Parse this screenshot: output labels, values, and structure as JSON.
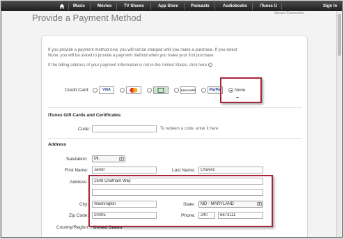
{
  "nav": {
    "items": [
      "Music",
      "Movies",
      "TV Shows",
      "App Store",
      "Podcasts",
      "Audiobooks",
      "iTunes U"
    ],
    "sign_in": "Sign In"
  },
  "secure_note": "Secure Connection",
  "title": "Provide a Payment Method",
  "intro": {
    "line1": "If you provide a payment method now, you will not be charged until you make a purchase. If you select",
    "line2": "None, you will be asked to provide a payment method when you make your first purchase.",
    "line3": "If the billing address of your payment information is not in the United States, click here"
  },
  "credit_card": {
    "label": "Credit Card:",
    "cards": [
      "VISA",
      "MC",
      "AMEX",
      "DISCOVER",
      "PayPal"
    ],
    "none_label": "None",
    "selected": "None"
  },
  "gift": {
    "heading": "iTunes Gift Cards and Certificates",
    "code_label": "Code:",
    "code_value": "",
    "hint": "To redeem a code, enter it here."
  },
  "address": {
    "heading": "Address",
    "salutation_label": "Salutation:",
    "salutation_value": "Mr.",
    "first_name_label": "First Name:",
    "first_name_value": "Jared",
    "last_name_label": "Last Name:",
    "last_name_value": "Chavez",
    "address_label": "Address:",
    "address_line1": "1608 Chatham Way",
    "address_line2": "",
    "city_label": "City:",
    "city_value": "Washington",
    "state_label": "State:",
    "state_value": "MD - MARYLAND",
    "zip_label": "Zip Code:",
    "zip_value": "20005",
    "phone_label": "Phone:",
    "phone_area": "240",
    "phone_number": "6673111",
    "country_label": "Country/Region:",
    "country_value": "United States"
  },
  "colors": {
    "highlight": "#a8263a",
    "nav_bg": "#2a2a2a"
  }
}
